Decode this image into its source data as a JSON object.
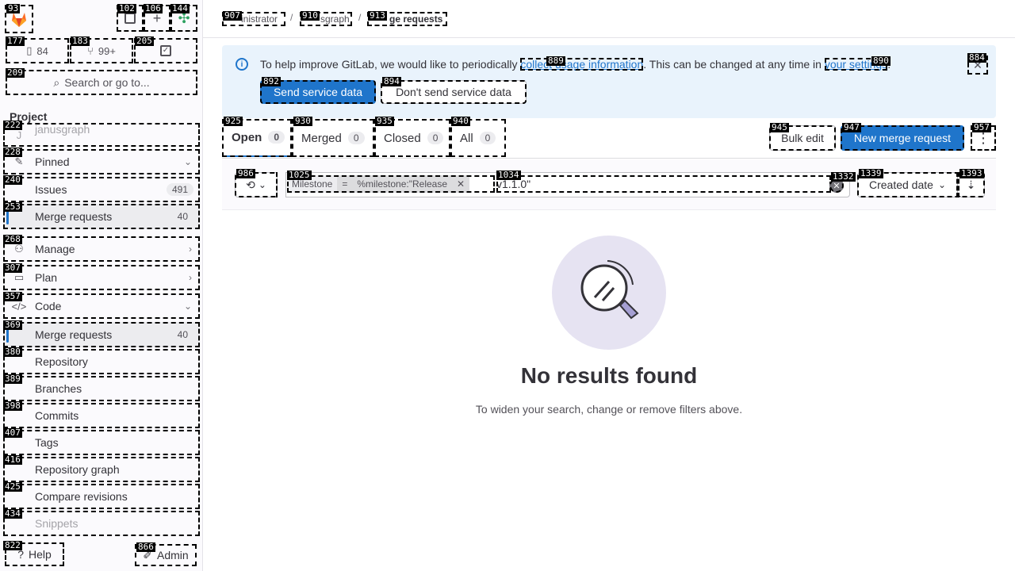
{
  "sidebar": {
    "issues_count_btn": "84",
    "mr_count_btn": "99+",
    "search_label": "Search or go to...",
    "section_title": "Project",
    "project_item": "janusgraph",
    "items": [
      {
        "label": "Pinned"
      },
      {
        "label": "Issues",
        "count": "491"
      },
      {
        "label": "Merge requests",
        "count": "40"
      },
      {
        "label": "Manage"
      },
      {
        "label": "Plan"
      },
      {
        "label": "Code"
      },
      {
        "label": "Merge requests",
        "count": "40"
      },
      {
        "label": "Repository"
      },
      {
        "label": "Branches"
      },
      {
        "label": "Commits"
      },
      {
        "label": "Tags"
      },
      {
        "label": "Repository graph"
      },
      {
        "label": "Compare revisions"
      },
      {
        "label": "Snippets"
      }
    ],
    "help_label": "Help",
    "admin_label": "Admin"
  },
  "breadcrumb": {
    "items": [
      "inistrator",
      "sgraph",
      "ge requests"
    ]
  },
  "banner": {
    "text_before": "To help improve GitLab, we would like to periodically",
    "link1": "collect usage information",
    "text_middle": ". This can be changed at any time in",
    "link2": "your settings",
    "text_end": ".",
    "send_label": "Send service data",
    "dont_send_label": "Don't send service data"
  },
  "tabs": [
    {
      "label": "Open",
      "count": "0"
    },
    {
      "label": "Merged",
      "count": "0"
    },
    {
      "label": "Closed",
      "count": "0"
    },
    {
      "label": "All",
      "count": "0"
    }
  ],
  "actions": {
    "bulk_edit": "Bulk edit",
    "new_mr": "New merge request"
  },
  "filter": {
    "token_type": "Milestone",
    "token_op": "=",
    "token_value": "%milestone:\"Release",
    "typed_text": "v1.1.0\"",
    "sort_label": "Created date"
  },
  "empty": {
    "title": "No results found",
    "description": "To widen your search, change or remove filters above."
  },
  "labels": {
    "l93": "93",
    "l102": "102",
    "l106": "106",
    "l144": "144",
    "l177": "177",
    "l183": "183",
    "l205": "205",
    "l209": "209",
    "l222": "222",
    "l228": "228",
    "l240": "240",
    "l253": "253",
    "l268": "268",
    "l307": "307",
    "l357": "357",
    "l369": "369",
    "l380": "380",
    "l389": "389",
    "l398": "398",
    "l407": "407",
    "l416": "416",
    "l425": "425",
    "l434": "434",
    "l822": "822",
    "l866": "866",
    "l907": "907",
    "l910": "910",
    "l913": "913",
    "l889": "889",
    "l890": "890",
    "l884": "884",
    "l892": "892",
    "l894": "894",
    "l925": "925",
    "l930": "930",
    "l935": "935",
    "l940": "940",
    "l945": "945",
    "l947": "947",
    "l957": "957",
    "l986": "986",
    "l1025": "1025",
    "l1034": "1034",
    "l1332": "1332",
    "l1339": "1339",
    "l1393": "1393"
  }
}
